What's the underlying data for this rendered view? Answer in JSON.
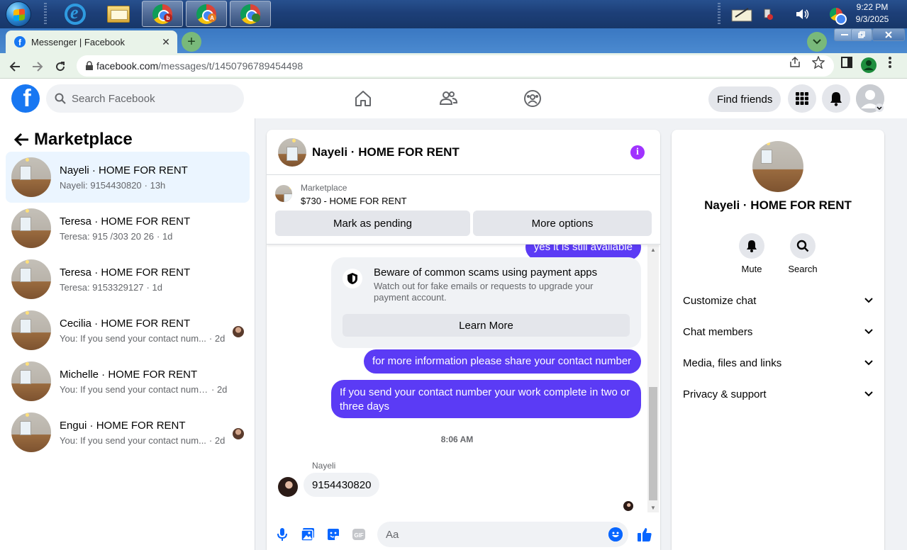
{
  "taskbar": {
    "clock_time": "9:22 PM",
    "clock_date": "9/3/2025",
    "chrome_profiles": [
      {
        "badge": "b",
        "badge_color": "#b3261e"
      },
      {
        "badge": "A",
        "badge_color": "#e67c1e"
      },
      {
        "badge": "",
        "badge_color": "#2e7d32"
      }
    ]
  },
  "browser": {
    "tab_title": "Messenger | Facebook",
    "tab_close": "✕",
    "new_tab": "+",
    "url_domain": "facebook.com",
    "url_path": "/messages/t/1450796789454498"
  },
  "fb_header": {
    "logo": "f",
    "search_placeholder": "Search Facebook",
    "find_friends": "Find friends"
  },
  "left_panel": {
    "title": "Marketplace",
    "conversations": [
      {
        "name": "Nayeli · HOME FOR RENT",
        "snippet": "Nayeli: 9154430820",
        "time": "· 13h",
        "selected": true,
        "has_avatar": false
      },
      {
        "name": "Teresa · HOME FOR RENT",
        "snippet": "Teresa: 915 /303 20 26",
        "time": "· 1d",
        "selected": false,
        "has_avatar": false
      },
      {
        "name": "Teresa · HOME FOR RENT",
        "snippet": "Teresa: 9153329127",
        "time": "· 1d",
        "selected": false,
        "has_avatar": false
      },
      {
        "name": "Cecilia · HOME FOR RENT",
        "snippet": "You: If you send your contact num...",
        "time": "· 2d",
        "selected": false,
        "has_avatar": true
      },
      {
        "name": "Michelle · HOME FOR RENT",
        "snippet": "You: If you send your contact number ...",
        "time": "· 2d",
        "selected": false,
        "has_avatar": false
      },
      {
        "name": "Engui · HOME FOR RENT",
        "snippet": "You: If you send your contact num...",
        "time": "· 2d",
        "selected": false,
        "has_avatar": true
      }
    ]
  },
  "chat": {
    "title": "Nayeli · HOME FOR RENT",
    "info_icon": "i",
    "marketplace_label": "Marketplace",
    "listing": "$730 - HOME FOR RENT",
    "mark_pending": "Mark as pending",
    "more_options": "More options",
    "partial_message": "yes it is still available",
    "scam_title": "Beware of common scams using payment apps",
    "scam_desc": "Watch out for fake emails or requests to upgrade your payment account.",
    "learn_more": "Learn More",
    "msg_share": "for more information please share your contact number",
    "msg_complete": "If you send your contact number your work complete in two or three days",
    "timestamp": "8:06 AM",
    "sender": "Nayeli",
    "reply": "9154430820",
    "input_placeholder": "Aa",
    "accent": "#5b3bf5"
  },
  "info_panel": {
    "name": "Nayeli · HOME FOR RENT",
    "mute": "Mute",
    "search": "Search",
    "sections": [
      "Customize chat",
      "Chat members",
      "Media, files and links",
      "Privacy & support"
    ]
  }
}
